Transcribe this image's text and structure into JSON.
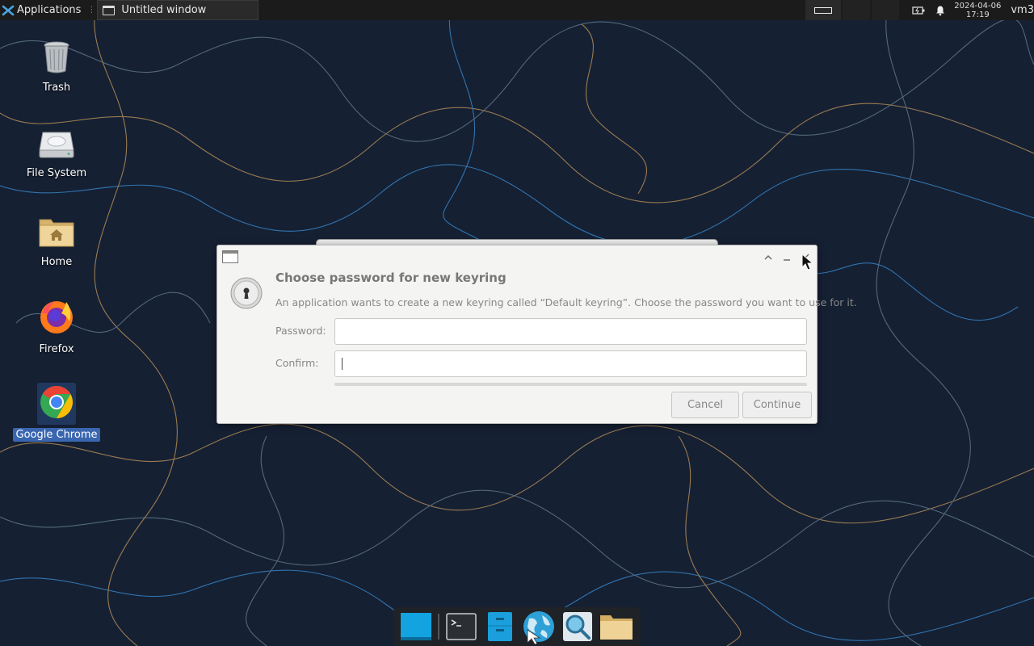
{
  "top_panel": {
    "applications_label": "Applications",
    "task_title": "Untitled window",
    "date": "2024-04-06",
    "time": "17:19",
    "user": "vm3"
  },
  "desktop_icons": [
    {
      "label": "Trash",
      "icon": "trash-icon"
    },
    {
      "label": "File System",
      "icon": "drive-icon"
    },
    {
      "label": "Home",
      "icon": "home-folder-icon"
    },
    {
      "label": "Firefox",
      "icon": "firefox-icon"
    },
    {
      "label": "Google Chrome",
      "icon": "chrome-icon",
      "selected": true
    }
  ],
  "dialog": {
    "title": "Choose password for new keyring",
    "message": "An application wants to create a new keyring called “Default keyring”. Choose the password you want to use for it.",
    "password_label": "Password:",
    "password_value": "",
    "confirm_label": "Confirm:",
    "confirm_value": "",
    "cancel_label": "Cancel",
    "continue_label": "Continue"
  },
  "dock_items": [
    "show-desktop-icon",
    "terminal-icon",
    "file-manager-icon",
    "web-browser-icon",
    "app-finder-icon",
    "folder-icon"
  ],
  "colors": {
    "wallpaper": "#152033",
    "panel": "#1b1b1b",
    "selection": "#3a66b0"
  }
}
